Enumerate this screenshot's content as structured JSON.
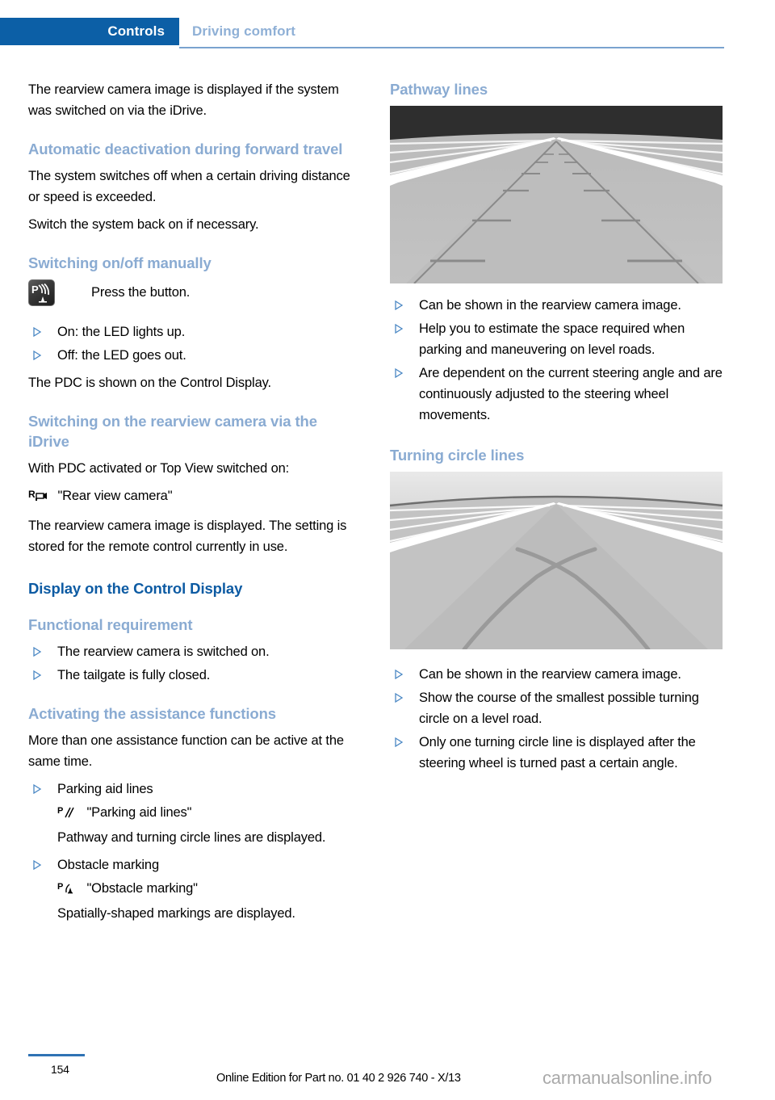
{
  "header": {
    "active_tab": "Controls",
    "inactive_tab": "Driving comfort",
    "active_bg": "#0c5fa6",
    "inactive_color": "#8fb0d6"
  },
  "left_column": {
    "intro_paragraph": "The rearview camera image is displayed if the system was switched on via the iDrive.",
    "section_auto_deactivation": {
      "heading": "Automatic deactivation during forward travel",
      "paragraph_1": "The system switches off when a certain driving distance or speed is exceeded.",
      "paragraph_2": "Switch the system back on if necessary."
    },
    "section_switching_manually": {
      "heading": "Switching on/off manually",
      "button_icon_name": "pdc-button-icon",
      "button_instruction": "Press the button.",
      "bullets": [
        "On: the LED lights up.",
        "Off: the LED goes out."
      ],
      "paragraph_after": "The PDC is shown on the Control Display."
    },
    "section_switching_idrive": {
      "heading": "Switching on the rearview camera via the iDrive",
      "paragraph_1": "With PDC activated or Top View switched on:",
      "menu_icon_name": "rear-view-camera-icon",
      "menu_label": "\"Rear view camera\"",
      "paragraph_2": "The rearview camera image is displayed. The setting is stored for the remote control currently in use."
    },
    "section_display": {
      "heading": "Display on the Control Display"
    },
    "section_functional_requirement": {
      "heading": "Functional requirement",
      "bullets": [
        "The rearview camera is switched on.",
        "The tailgate is fully closed."
      ]
    },
    "section_activating": {
      "heading": "Activating the assistance functions",
      "paragraph_1": "More than one assistance function can be active at the same time.",
      "items": [
        {
          "bullet": "Parking aid lines",
          "menu_icon_name": "parking-aid-lines-icon",
          "menu_label": "\"Parking aid lines\"",
          "description": "Pathway and turning circle lines are displayed."
        },
        {
          "bullet": "Obstacle marking",
          "menu_icon_name": "obstacle-marking-icon",
          "menu_label": "\"Obstacle marking\"",
          "description": "Spatially-shaped markings are displayed."
        }
      ]
    }
  },
  "right_column": {
    "section_pathway": {
      "heading": "Pathway lines",
      "figure_name": "pathway-lines-figure",
      "bullets": [
        "Can be shown in the rearview camera image.",
        "Help you to estimate the space required when parking and maneuvering on level roads.",
        "Are dependent on the current steering angle and are continuously adjusted to the steering wheel movements."
      ]
    },
    "section_turning": {
      "heading": "Turning circle lines",
      "figure_name": "turning-circle-lines-figure",
      "bullets": [
        "Can be shown in the rearview camera image.",
        "Show the course of the smallest possible turning circle on a level road.",
        "Only one turning circle line is displayed after the steering wheel is turned past a certain angle."
      ]
    }
  },
  "footer": {
    "page_number": "154",
    "edition_text": "Online Edition for Part no. 01 40 2 926 740 - X/13",
    "watermark_text": "carmanualsonline.info",
    "rule_color": "#2f72b4"
  }
}
